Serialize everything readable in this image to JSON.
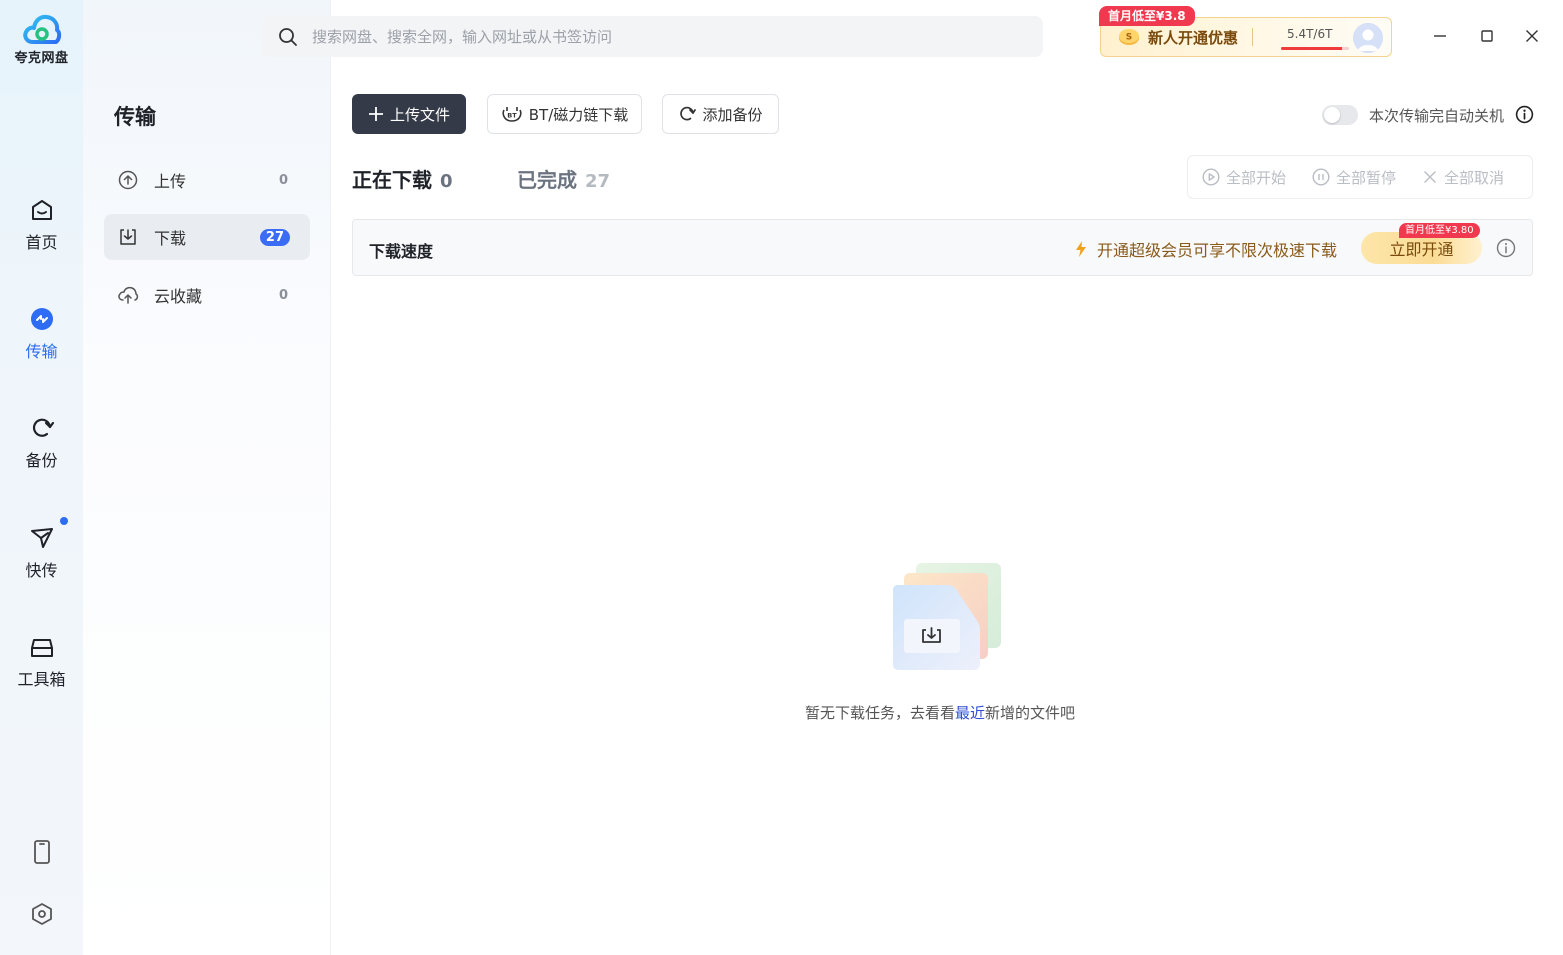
{
  "app": {
    "name": "夸克网盘"
  },
  "rail": {
    "items": [
      {
        "label": "首页",
        "icon": "home-icon"
      },
      {
        "label": "传输",
        "icon": "transfer-icon"
      },
      {
        "label": "备份",
        "icon": "backup-icon"
      },
      {
        "label": "快传",
        "icon": "quick-send-icon"
      },
      {
        "label": "工具箱",
        "icon": "toolbox-icon"
      }
    ],
    "active": "传输"
  },
  "subnav": {
    "title": "传输",
    "items": [
      {
        "label": "上传",
        "count": "0"
      },
      {
        "label": "下载",
        "count": "27"
      },
      {
        "label": "云收藏",
        "count": "0"
      }
    ]
  },
  "search": {
    "placeholder": "搜索网盘、搜索全网，输入网址或从书签访问"
  },
  "promo": {
    "tag": "首月低至¥3.8",
    "text": "新人开通优惠",
    "quota": "5.4T/6T",
    "quota_fraction": 0.9
  },
  "toolbar": {
    "upload": "上传文件",
    "bt": "BT/磁力链下载",
    "backup": "添加备份",
    "auto_shutdown": "本次传输完自动关机",
    "auto_shutdown_on": false
  },
  "tabs": {
    "downloading": {
      "label": "正在下载",
      "count": "0"
    },
    "completed": {
      "label": "已完成",
      "count": "27"
    }
  },
  "bulk": {
    "start": "全部开始",
    "pause": "全部暂停",
    "cancel": "全部取消"
  },
  "speed": {
    "title": "下载速度",
    "promo": "开通超级会员可享不限次极速下载",
    "cta": "立即开通",
    "cta_tag": "首月低至¥3.80"
  },
  "empty": {
    "before": "暂无下载任务，去看看",
    "link": "最近",
    "after": "新增的文件吧"
  },
  "colors": {
    "accent": "#2d6cf3",
    "primary_button": "#343a48",
    "badge": "#3b6df4",
    "promo_red": "#f0384e"
  }
}
